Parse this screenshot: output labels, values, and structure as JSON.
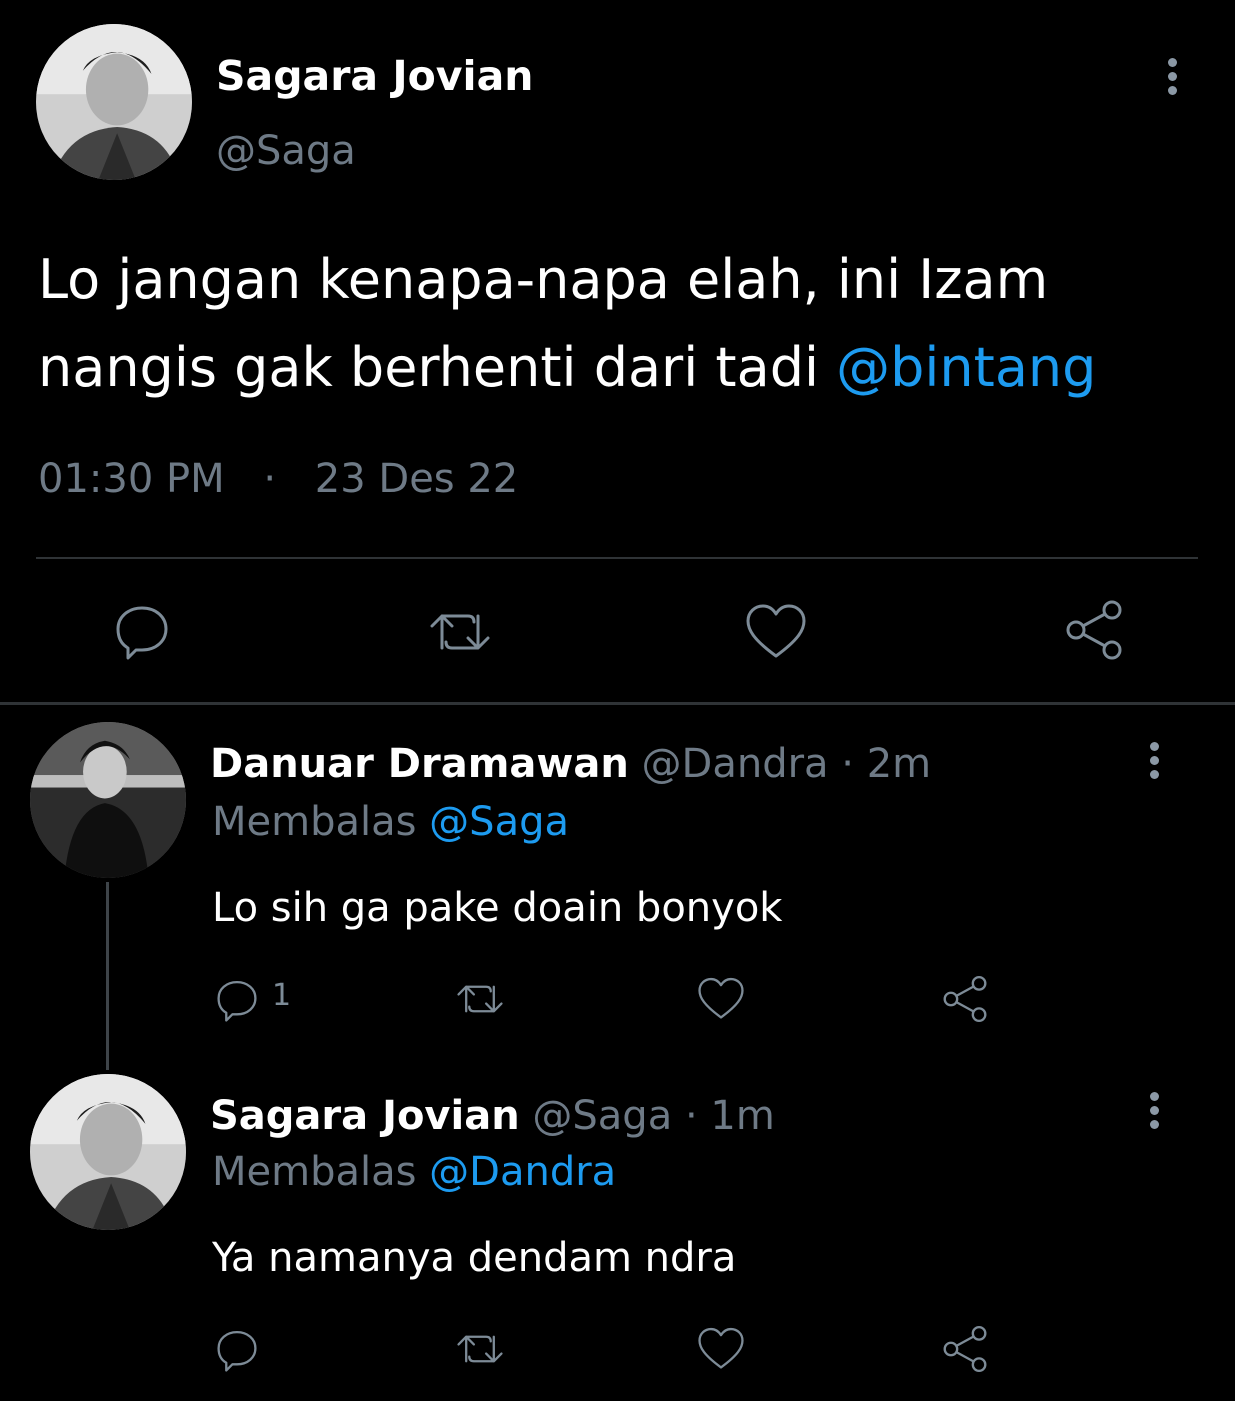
{
  "main_tweet": {
    "display_name": "Sagara Jovian",
    "handle": "@Saga",
    "text": "Lo jangan kenapa-napa elah, ini Izam nangis gak berhenti dari tadi ",
    "mention": "@bintang",
    "time": "01:30 PM",
    "separator": "·",
    "date": "23 Des 22",
    "actions": [
      "reply-icon",
      "retweet-icon",
      "like-icon",
      "share-icon"
    ]
  },
  "replies": [
    {
      "display_name": "Danuar Dramawan",
      "handle": "@Dandra",
      "separator": "·",
      "time_ago": "2m",
      "replying_prefix": "Membalas",
      "replying_to": "@Saga",
      "text": "Lo sih ga pake doain bonyok",
      "reply_count": "1"
    },
    {
      "display_name": "Sagara Jovian",
      "handle": "@Saga",
      "separator": "·",
      "time_ago": "1m",
      "replying_prefix": "Membalas",
      "replying_to": "@Dandra",
      "text": "Ya namanya dendam ndra",
      "reply_count": ""
    }
  ],
  "colors": {
    "background": "#000000",
    "text": "#ffffff",
    "muted": "#6e7a86",
    "link": "#1d9bf0",
    "divider": "#2f3336"
  }
}
